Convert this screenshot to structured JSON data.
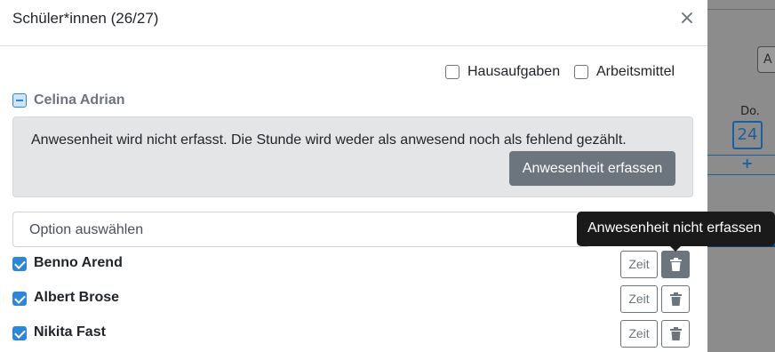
{
  "modal": {
    "title": "Schüler*innen (26/27)",
    "close_glyph": "×"
  },
  "filters": {
    "homework_label": "Hausaufgaben",
    "materials_label": "Arbeitsmittel"
  },
  "current_student": {
    "name": "Celina Adrian",
    "alert_text": "Anwesenheit wird nicht erfasst. Die Stunde wird weder als anwesend noch als fehlend gezählt.",
    "alert_button": "Anwesenheit erfassen"
  },
  "select": {
    "placeholder": "Option auswählen"
  },
  "tooltip": {
    "text": "Anwesenheit nicht erfassen"
  },
  "students": [
    {
      "name": "Benno Arend",
      "time_label": "Zeit"
    },
    {
      "name": "Albert Brose",
      "time_label": "Zeit"
    },
    {
      "name": "Nikita Fast",
      "time_label": "Zeit"
    }
  ],
  "background": {
    "button_letter": "A",
    "day": "Do.",
    "date": "24",
    "plus": "+"
  },
  "colors": {
    "accent": "#2e86d6",
    "secondary": "#6c757d",
    "alert_bg": "#e4e5e7",
    "tooltip_bg": "#1a1a1a"
  },
  "icons": {
    "close": "close-icon",
    "delete": "trash-icon"
  }
}
